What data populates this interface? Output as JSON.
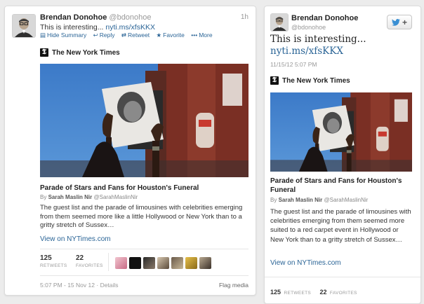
{
  "tweet_a": {
    "author_name": "Brendan Donohoe",
    "author_handle": "@bdonohoe",
    "time_ago": "1h",
    "text": "This is interesting...",
    "link": "nyti.ms/xfsKKX",
    "actions": {
      "hide_summary": "Hide Summary",
      "reply": "Reply",
      "retweet": "Retweet",
      "favorite": "Favorite",
      "more": "More"
    },
    "source": "The New York Times",
    "headline": "Parade of Stars and Fans for Houston's Funeral",
    "byline_prefix": "By",
    "byline_author": "Sarah Maslin Nir",
    "byline_handle": "@SarahMaslinNir",
    "description": "The guest list and the parade of limousines with celebrities emerging from them seemed more like a little Hollywood or New York than to a gritty stretch of Sussex…",
    "view_link": "View on NYTimes.com",
    "retweets_count": "125",
    "retweets_label": "RETWEETS",
    "favorites_count": "22",
    "favorites_label": "FAVORITES",
    "timestamp": "5:07 PM - 15 Nov 12",
    "details": "Details",
    "flag_media": "Flag media"
  },
  "tweet_b": {
    "author_name": "Brendan Donohoe",
    "author_handle": "@bdonohoe",
    "text": "This is interesting...",
    "link": "nyti.ms/xfsKKX",
    "timestamp": "11/15/12 5:07 PM",
    "source": "The New York Times",
    "headline": "Parade of Stars and Fans for Houston's Funeral",
    "byline_prefix": "By",
    "byline_author": "Sarah Maslin Nir",
    "byline_handle": "@SarahMaslinNir",
    "description": "The guest list and the parade of limousines with celebrities emerging from them seemed more suited to a red carpet event in Hollywood or New York than to a gritty stretch of Sussex…",
    "view_link": "View on NYTimes.com",
    "retweets_count": "125",
    "retweets_label": "RETWEETS",
    "favorites_count": "22",
    "favorites_label": "FAVORITES",
    "follow_icon": "twitter-bird-icon",
    "follow_symbol": "+"
  },
  "icons": {
    "reply": "reply-arrow-icon",
    "retweet": "retweet-icon",
    "favorite": "star-icon",
    "more": "ellipsis-icon",
    "nyt": "nyt-logo-icon"
  },
  "colors": {
    "link": "#2a6496",
    "twitter_blue": "#3a8fd3",
    "muted": "#999999"
  }
}
